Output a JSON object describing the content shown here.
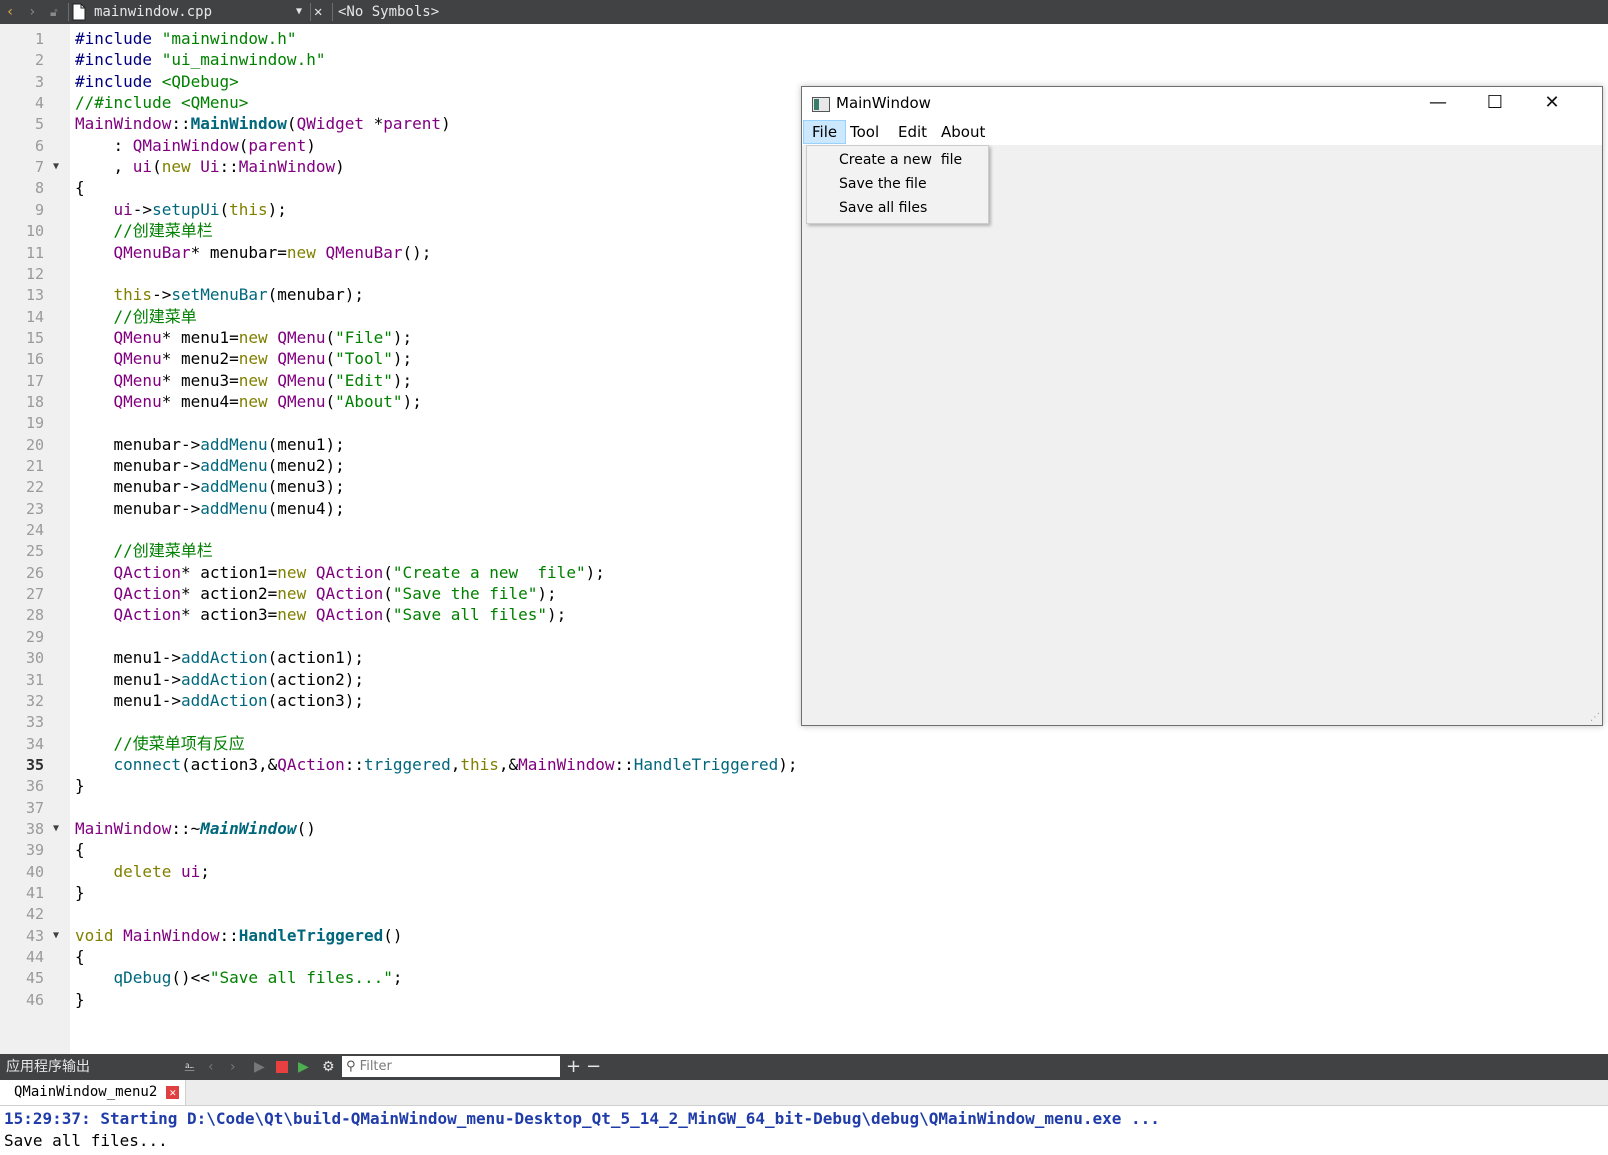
{
  "toolbar": {
    "back_icon": "chevron-left-icon",
    "forward_icon": "chevron-right-icon",
    "file_name": "mainwindow.cpp",
    "symbols": "<No Symbols>"
  },
  "editor": {
    "current_line": 35,
    "lines": [
      "#include \"mainwindow.h\"",
      "#include \"ui_mainwindow.h\"",
      "#include <QDebug>",
      "//#include <QMenu>",
      "MainWindow::MainWindow(QWidget *parent)",
      "    : QMainWindow(parent)",
      "    , ui(new Ui::MainWindow)",
      "{",
      "    ui->setupUi(this);",
      "    //创建菜单栏",
      "    QMenuBar* menubar=new QMenuBar();",
      "",
      "    this->setMenuBar(menubar);",
      "    //创建菜单",
      "    QMenu* menu1=new QMenu(\"File\");",
      "    QMenu* menu2=new QMenu(\"Tool\");",
      "    QMenu* menu3=new QMenu(\"Edit\");",
      "    QMenu* menu4=new QMenu(\"About\");",
      "",
      "    menubar->addMenu(menu1);",
      "    menubar->addMenu(menu2);",
      "    menubar->addMenu(menu3);",
      "    menubar->addMenu(menu4);",
      "",
      "    //创建菜单栏",
      "    QAction* action1=new QAction(\"Create a new  file\");",
      "    QAction* action2=new QAction(\"Save the file\");",
      "    QAction* action3=new QAction(\"Save all files\");",
      "",
      "    menu1->addAction(action1);",
      "    menu1->addAction(action2);",
      "    menu1->addAction(action3);",
      "",
      "    //使菜单项有反应",
      "    connect(action3,&QAction::triggered,this,&MainWindow::HandleTriggered);",
      "}",
      "",
      "MainWindow::~MainWindow()",
      "{",
      "    delete ui;",
      "}",
      "",
      "void MainWindow::HandleTriggered()",
      "{",
      "    qDebug()<<\"Save all files...\";",
      "}"
    ]
  },
  "app_window": {
    "title": "MainWindow",
    "minimize": "—",
    "maximize": "☐",
    "close": "✕",
    "menus": [
      "File",
      "Tool",
      "Edit",
      "About"
    ],
    "active_menu": "File",
    "file_menu_items": [
      "Create a new  file",
      "Save the file",
      "Save all files"
    ]
  },
  "output_pane": {
    "title": "应用程序输出",
    "filter_placeholder": "Filter",
    "add": "+",
    "remove": "−",
    "tab": "QMainWindow_menu2",
    "lines": [
      "15:29:37: Starting D:\\Code\\Qt\\build-QMainWindow_menu-Desktop_Qt_5_14_2_MinGW_64_bit-Debug\\debug\\QMainWindow_menu.exe ...",
      "Save all files..."
    ]
  }
}
